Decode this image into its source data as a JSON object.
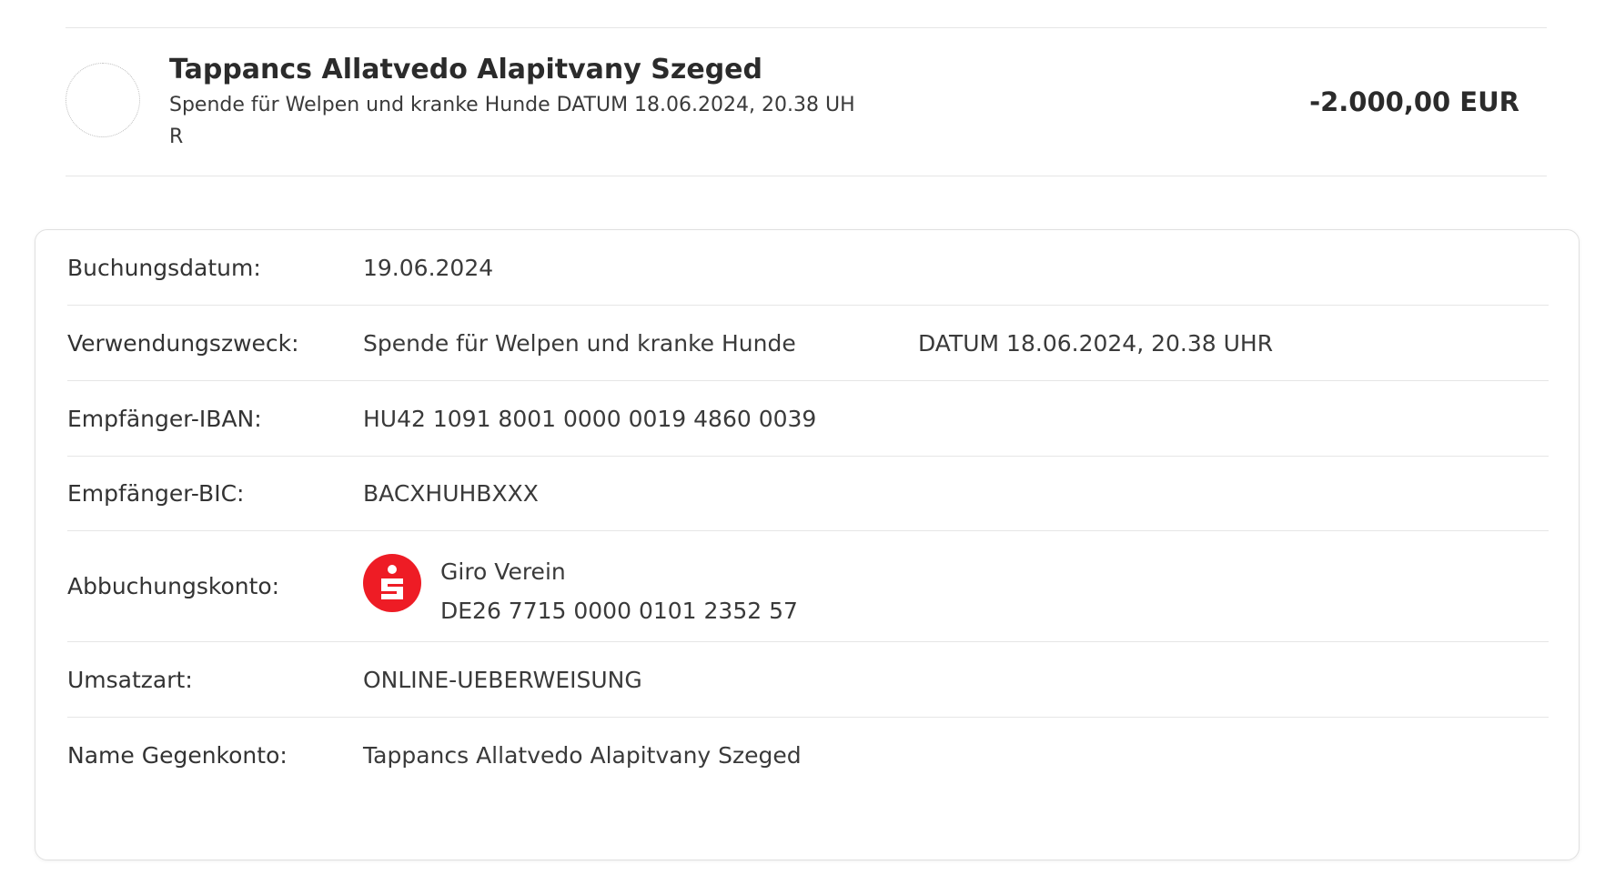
{
  "transaction": {
    "title": "Tappancs Allatvedo Alapitvany Szeged",
    "subtitle": "Spende für Welpen und kranke Hunde DATUM 18.06.2024, 20.38 UHR",
    "amount": "-2.000,00 EUR",
    "avatar_icon": "placeholder-circle"
  },
  "details": {
    "booking_date": {
      "label": "Buchungsdatum:",
      "value": "19.06.2024"
    },
    "purpose": {
      "label": "Verwendungszweck:",
      "value": "Spende für Welpen und kranke Hunde",
      "value2": "DATUM 18.06.2024, 20.38 UHR"
    },
    "recipient_iban": {
      "label": "Empfänger-IBAN:",
      "value": "HU42 1091 8001 0000 0019 4860 0039"
    },
    "recipient_bic": {
      "label": "Empfänger-BIC:",
      "value": "BACXHUHBXXX"
    },
    "debit_account": {
      "label": "Abbuchungskonto:",
      "account_name": "Giro Verein",
      "account_iban": "DE26 7715 0000 0101 2352 57",
      "bank_icon": "sparkasse-logo-icon",
      "bank_color": "#ee1c25"
    },
    "transaction_type": {
      "label": "Umsatzart:",
      "value": "ONLINE-UEBERWEISUNG"
    },
    "counterparty_name": {
      "label": "Name Gegenkonto:",
      "value": "Tappancs Allatvedo Alapitvany Szeged"
    }
  }
}
